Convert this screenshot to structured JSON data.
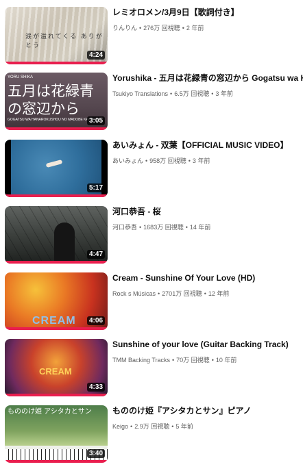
{
  "videos": [
    {
      "title": "レミオロメン/3月9日【歌詞付き】",
      "channel": "りんりん",
      "views": "276万 回視聴",
      "age": "2 年前",
      "duration": "4:24",
      "thumb_text": "涙が溢れてくる ありがとう",
      "watched": true
    },
    {
      "title": "Yorushika - 五月は花緑青の窓辺から Gogatsu wa Hanaro",
      "channel": "Tsukiyo Translations",
      "views": "6.5万 回視聴",
      "age": "3 年前",
      "duration": "3:05",
      "thumb_text": "五月は花緑青の窓辺から",
      "thumb_small": "YORU SHIKA",
      "thumb_small2": "GOGATSU WA HANAROKUSHOU NO MADOBE KARA",
      "watched": true
    },
    {
      "title": "あいみょん - 双葉【OFFICIAL MUSIC VIDEO】",
      "channel": "あいみょん",
      "views": "958万 回視聴",
      "age": "3 年前",
      "duration": "5:17",
      "watched": true
    },
    {
      "title": "河口恭吾 - 桜",
      "channel": "河口恭吾",
      "views": "1683万 回視聴",
      "age": "14 年前",
      "duration": "4:47",
      "watched": true
    },
    {
      "title": "Cream - Sunshine Of Your Love (HD)",
      "channel": "Rock s Músicas",
      "views": "2701万 回視聴",
      "age": "12 年前",
      "duration": "4:06",
      "thumb_text": "CREAM",
      "watched": true
    },
    {
      "title": "Sunshine of your love (Guitar Backing Track)",
      "channel": "TMM Backing Tracks",
      "views": "70万 回視聴",
      "age": "10 年前",
      "duration": "4:33",
      "thumb_text": "CREAM",
      "watched": true
    },
    {
      "title": "もののけ姫『アシタカとサン』ピアノ",
      "channel": "Keigo",
      "views": "2.9万 回視聴",
      "age": "5 年前",
      "duration": "3:40",
      "thumb_text": "もののけ姫 アシタカとサン",
      "watched": true
    }
  ],
  "separator": "•"
}
